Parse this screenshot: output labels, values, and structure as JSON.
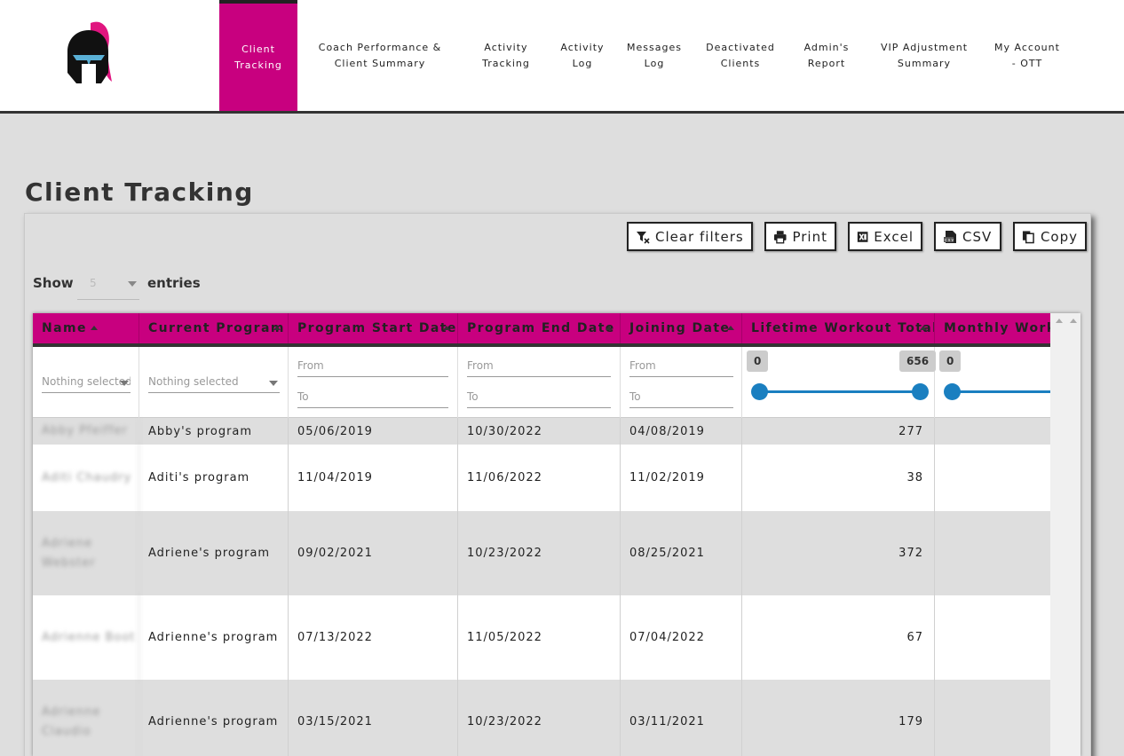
{
  "nav": {
    "items": [
      {
        "label": "Client Tracking",
        "line1": "Client",
        "line2": "Tracking"
      },
      {
        "label": "Coach Performance & Client Summary",
        "line1": "Coach Performance &",
        "line2": "Client Summary"
      },
      {
        "label": "Activity Tracking",
        "line1": "Activity",
        "line2": "Tracking"
      },
      {
        "label": "Activity Log",
        "line1": "Activity",
        "line2": "Log"
      },
      {
        "label": "Messages Log",
        "line1": "Messages",
        "line2": "Log"
      },
      {
        "label": "Deactivated Clients",
        "line1": "Deactivated",
        "line2": "Clients"
      },
      {
        "label": "Admin's Report",
        "line1": "Admin's",
        "line2": "Report"
      },
      {
        "label": "VIP Adjustment Summary",
        "line1": "VIP Adjustment",
        "line2": "Summary"
      },
      {
        "label": "My Account - OTT",
        "line1": "My Account",
        "line2": "- OTT"
      }
    ],
    "active_index": 0,
    "accent_color": "#c8007f"
  },
  "logo": {
    "icon": "spartan-helmet-icon"
  },
  "page": {
    "title": "Client Tracking"
  },
  "toolbar": {
    "clear_filters": "Clear filters",
    "print": "Print",
    "excel": "Excel",
    "csv": "CSV",
    "copy": "Copy"
  },
  "length": {
    "show_label": "Show",
    "value": "5",
    "entries_label": "entries"
  },
  "table": {
    "headers": {
      "name": "Name",
      "program": "Current Program",
      "start": "Program Start Date",
      "end": "Program End Date",
      "joining": "Joining Date",
      "lifetime": "Lifetime Workout Total",
      "monthly": "Monthly Workout"
    },
    "filters": {
      "name_placeholder": "Nothing selected",
      "program_placeholder": "Nothing selected",
      "from_placeholder": "From",
      "to_placeholder": "To",
      "lifetime_min": "0",
      "lifetime_max": "656",
      "monthly_min": "0"
    },
    "rows": [
      {
        "name": "Abby Pfeiffer",
        "program": "Abby's program",
        "start": "05/06/2019",
        "end": "10/30/2022",
        "joining": "04/08/2019",
        "lifetime": "277"
      },
      {
        "name": "Aditi Chaudry",
        "program": "Aditi's program",
        "start": "11/04/2019",
        "end": "11/06/2022",
        "joining": "11/02/2019",
        "lifetime": "38"
      },
      {
        "name": "Adriene Webster",
        "program": "Adriene's program",
        "start": "09/02/2021",
        "end": "10/23/2022",
        "joining": "08/25/2021",
        "lifetime": "372"
      },
      {
        "name": "Adrienne Boot",
        "program": "Adrienne's program",
        "start": "07/13/2022",
        "end": "11/05/2022",
        "joining": "07/04/2022",
        "lifetime": "67"
      },
      {
        "name": "Adrienne Claudio",
        "program": "Adrienne's program",
        "start": "03/15/2021",
        "end": "10/23/2022",
        "joining": "03/11/2021",
        "lifetime": "179"
      }
    ]
  }
}
